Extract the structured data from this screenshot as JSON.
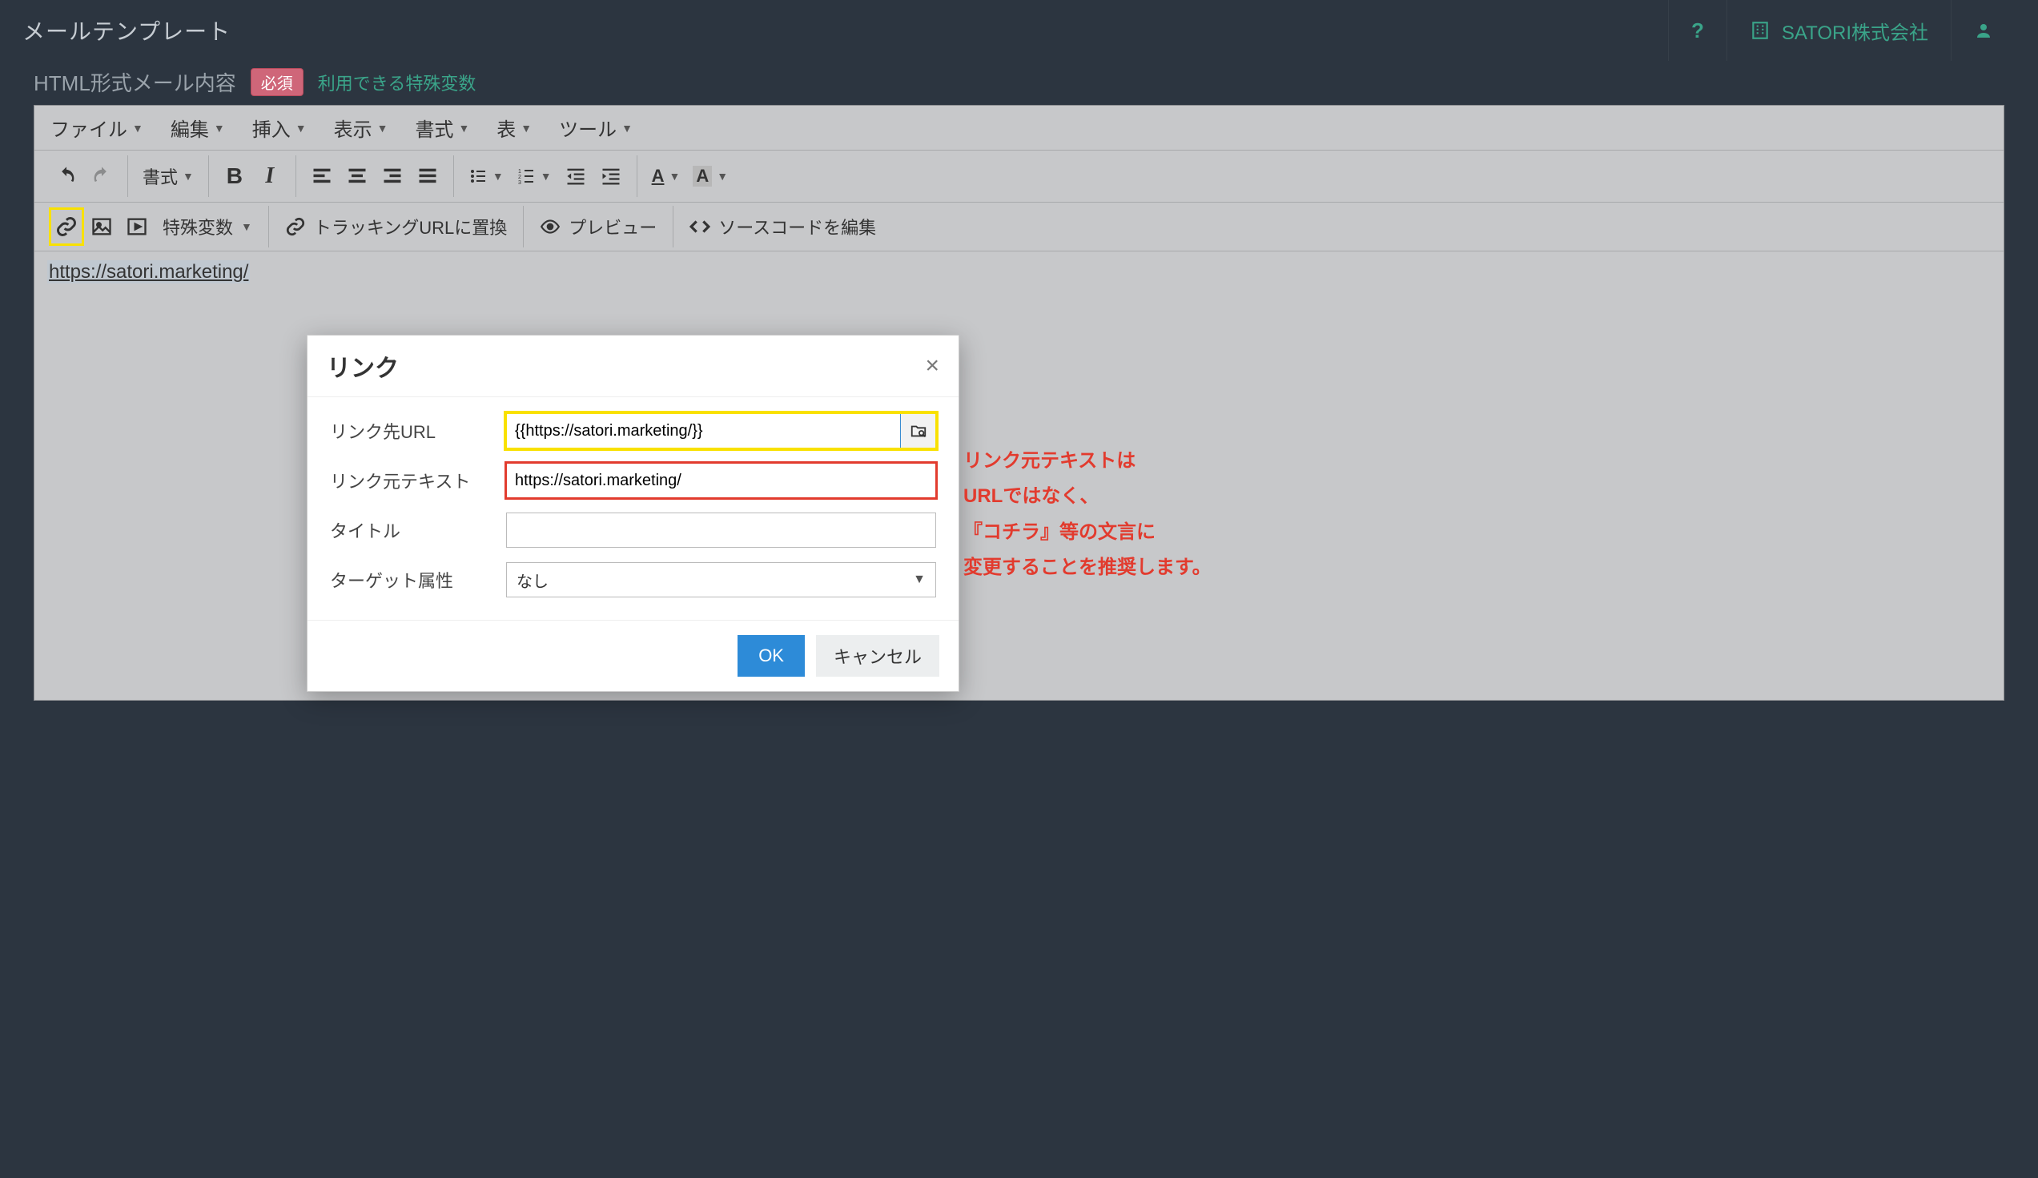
{
  "topbar": {
    "title": "メールテンプレート",
    "help_label": "?",
    "company": "SATORI株式会社"
  },
  "section": {
    "label": "HTML形式メール内容",
    "required_badge": "必須",
    "vars_link": "利用できる特殊変数"
  },
  "menubar": {
    "file": "ファイル",
    "edit": "編集",
    "insert": "挿入",
    "view": "表示",
    "format": "書式",
    "table": "表",
    "tools": "ツール"
  },
  "toolbar": {
    "format_dropdown": "書式",
    "special_vars": "特殊変数",
    "tracking_url": "トラッキングURLに置換",
    "preview": "プレビュー",
    "source_code": "ソースコードを編集"
  },
  "canvas": {
    "selected_link_text": "https://satori.marketing/"
  },
  "dialog": {
    "title": "リンク",
    "close": "×",
    "fields": {
      "url_label": "リンク先URL",
      "url_value": "{{https://satori.marketing/}}",
      "text_label": "リンク元テキスト",
      "text_value": "https://satori.marketing/",
      "title_label": "タイトル",
      "title_value": "",
      "target_label": "ターゲット属性",
      "target_value": "なし"
    },
    "ok": "OK",
    "cancel": "キャンセル"
  },
  "annotation": {
    "line1": "リンク元テキストは",
    "line2": "URLではなく、",
    "line3": "『コチラ』等の文言に",
    "line4": "変更することを推奨します。"
  }
}
